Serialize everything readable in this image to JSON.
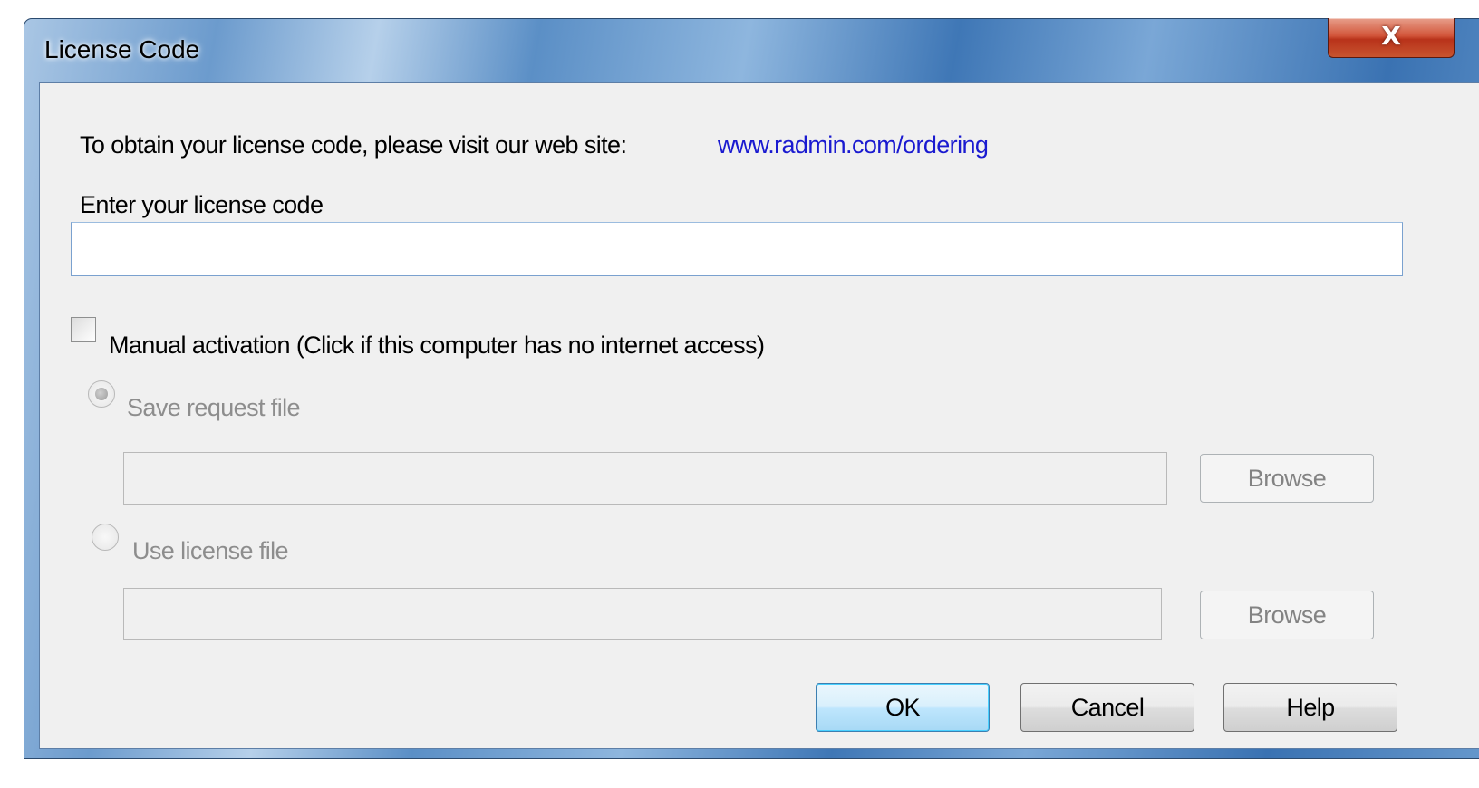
{
  "window": {
    "title": "License Code",
    "close_glyph": "X"
  },
  "intro": {
    "text": "To obtain your license code, please visit our web site:",
    "link": "www.radmin.com/ordering"
  },
  "license_code": {
    "label": "Enter your license code",
    "value": ""
  },
  "manual_activation": {
    "label": "Manual activation (Click if this computer has no internet access)",
    "checked": false
  },
  "save_request": {
    "label": "Save request file",
    "selected": true,
    "path": "",
    "browse_label": "Browse"
  },
  "use_license": {
    "label": "Use license file",
    "selected": false,
    "path": "",
    "browse_label": "Browse"
  },
  "buttons": {
    "ok": "OK",
    "cancel": "Cancel",
    "help": "Help"
  },
  "colors": {
    "link": "#1a1ad0",
    "disabled_text": "#8d8d8d",
    "client_bg": "#f0f0f0",
    "close_button": "#c8452a"
  }
}
